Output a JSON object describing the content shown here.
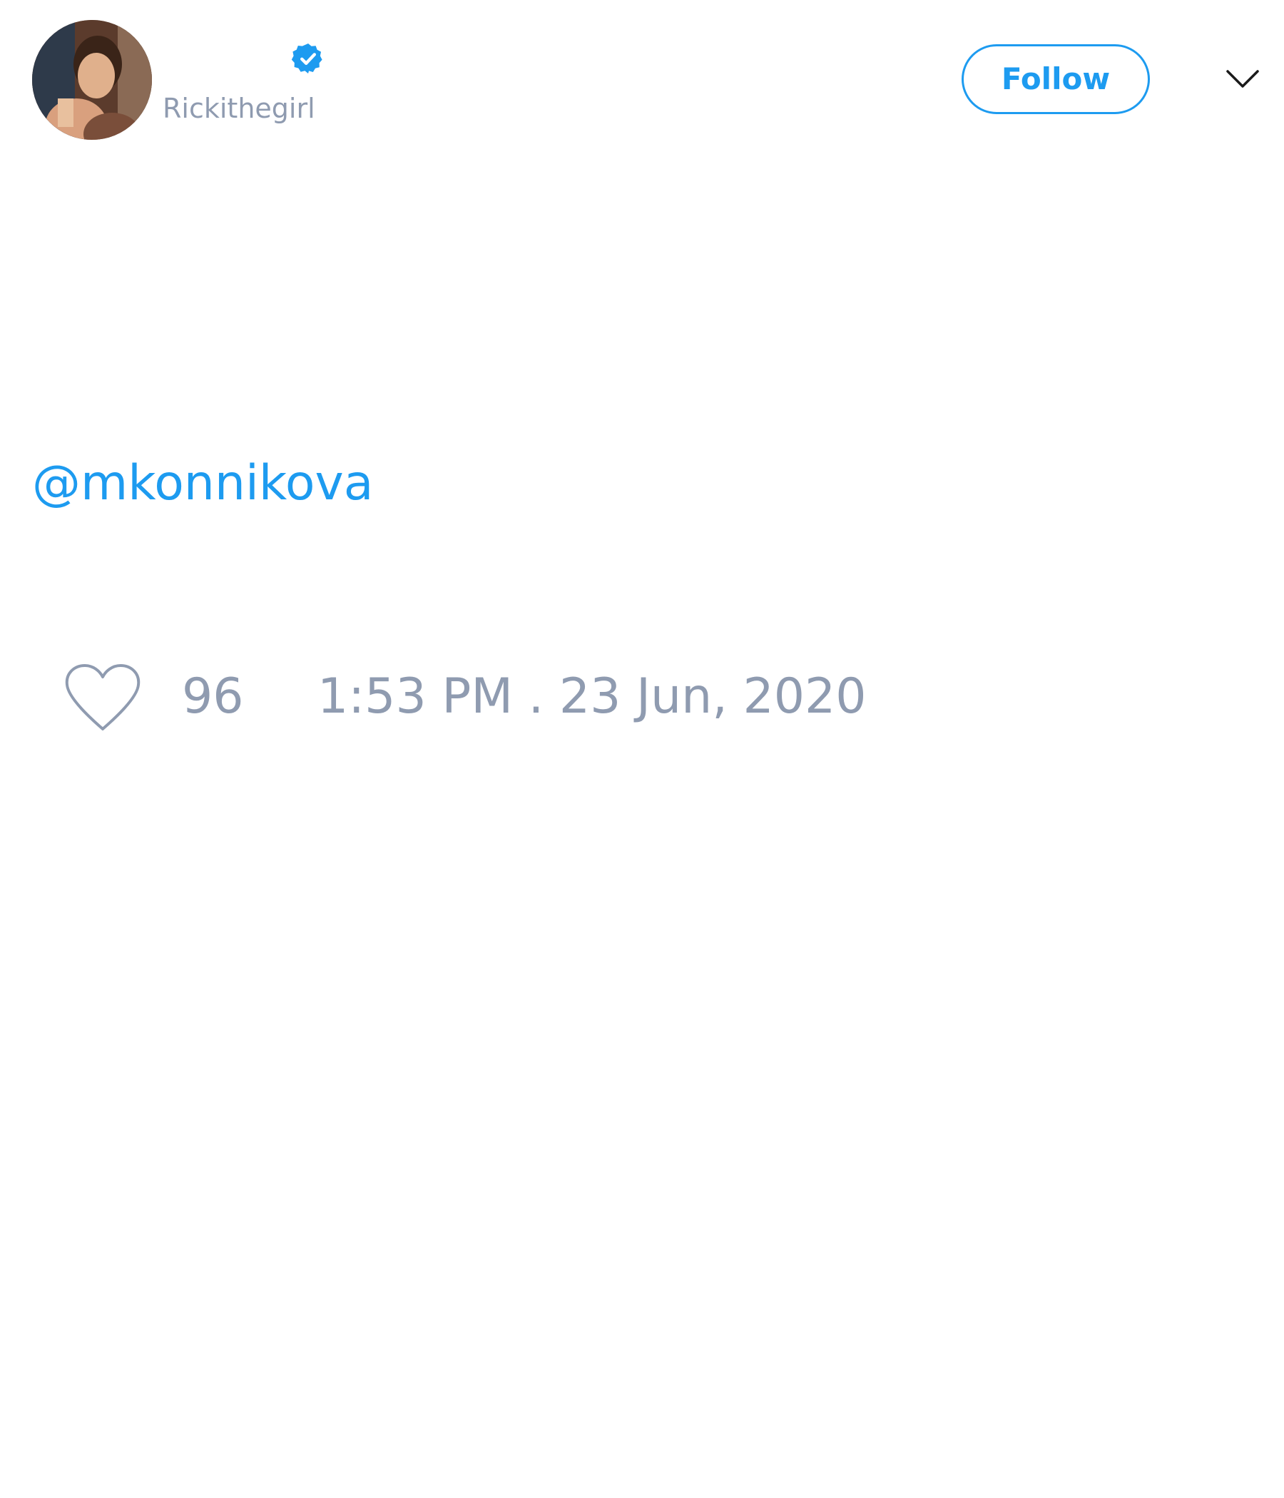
{
  "author": {
    "handle": "Rickithegirl",
    "verified": true,
    "avatar": "profile-photo"
  },
  "header": {
    "follow_label": "Follow",
    "menu_icon": "chevron-down-icon"
  },
  "tweet": {
    "mention": "@mkonnikova",
    "like_count": "96",
    "like_icon": "heart-outline-icon",
    "timestamp": "1:53 PM . 23 Jun, 2020"
  },
  "colors": {
    "accent": "#1d9bf0",
    "muted_text": "#8f9bb0",
    "background": "#ffffff"
  }
}
